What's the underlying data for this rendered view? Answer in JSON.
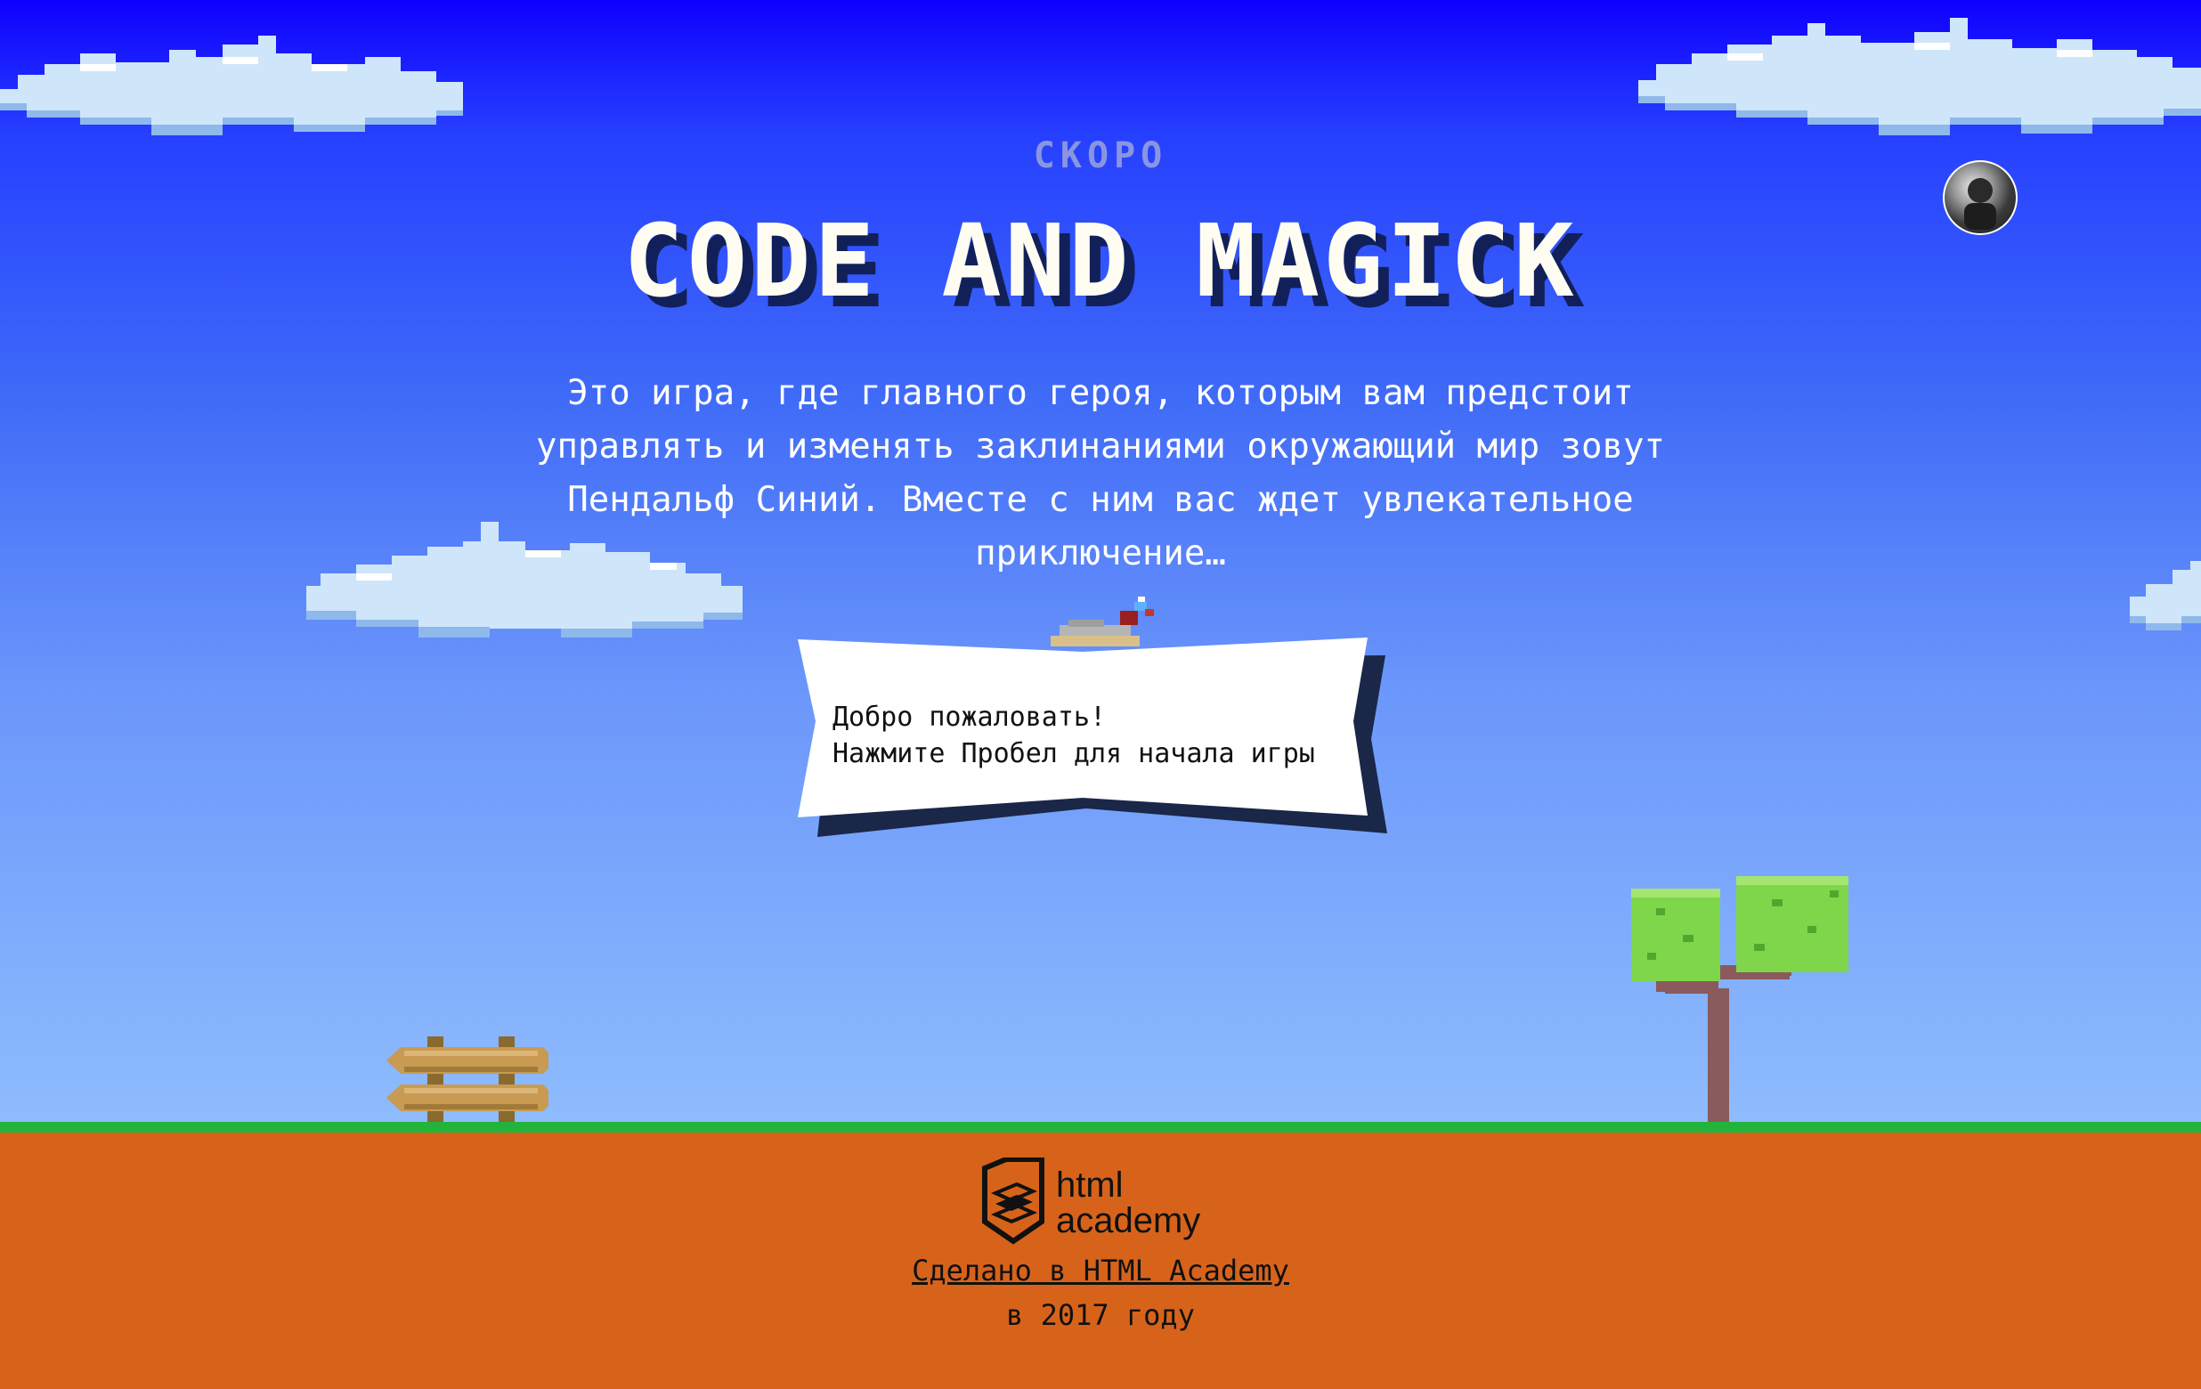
{
  "header": {
    "subtitle": "СКОРО",
    "title": "CODE AND MAGICK",
    "description": "Это игра, где главного героя, которым вам предстоит управлять и изменять заклинаниями окружающий мир зовут Пендальф Синий. Вместе с ним вас ждет увлекательное приключение…"
  },
  "game": {
    "welcome_line1": "Добро пожаловать!",
    "welcome_line2": "Нажмите Пробел для начала игры"
  },
  "footer": {
    "logo_line1": "html",
    "logo_line2": "academy",
    "made_in": "Сделано в HTML Academy",
    "year": "в 2017 году"
  },
  "colors": {
    "sky_top": "#0f00ff",
    "sky_bottom": "#8ebcfd",
    "grass": "#22b43a",
    "ground": "#d7631b",
    "title_fill": "#fffdf2",
    "title_shadow": "#12205a"
  },
  "icons": {
    "avatar": "user-avatar",
    "logo": "html-academy-logo"
  }
}
